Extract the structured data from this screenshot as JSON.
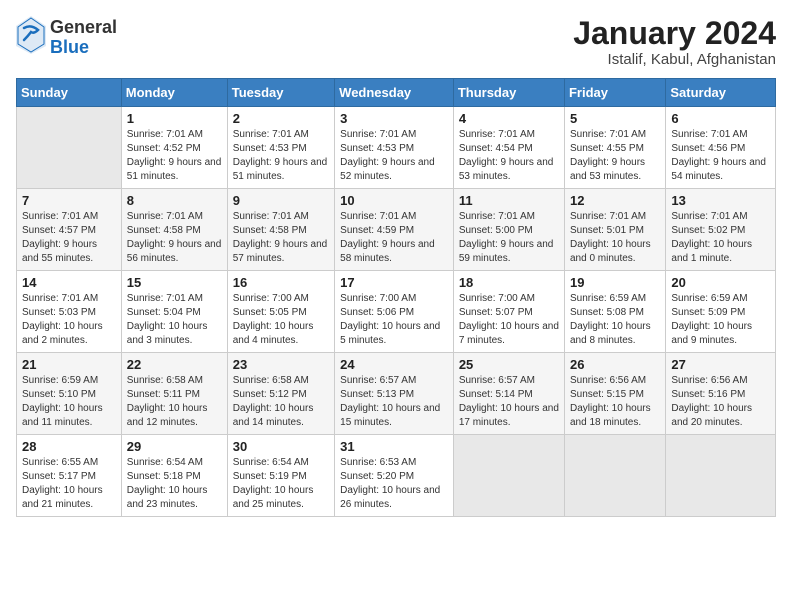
{
  "logo": {
    "general": "General",
    "blue": "Blue"
  },
  "title": "January 2024",
  "subtitle": "Istalif, Kabul, Afghanistan",
  "headers": [
    "Sunday",
    "Monday",
    "Tuesday",
    "Wednesday",
    "Thursday",
    "Friday",
    "Saturday"
  ],
  "weeks": [
    [
      {
        "day": "",
        "sunrise": "",
        "sunset": "",
        "daylight": ""
      },
      {
        "day": "1",
        "sunrise": "Sunrise: 7:01 AM",
        "sunset": "Sunset: 4:52 PM",
        "daylight": "Daylight: 9 hours and 51 minutes."
      },
      {
        "day": "2",
        "sunrise": "Sunrise: 7:01 AM",
        "sunset": "Sunset: 4:53 PM",
        "daylight": "Daylight: 9 hours and 51 minutes."
      },
      {
        "day": "3",
        "sunrise": "Sunrise: 7:01 AM",
        "sunset": "Sunset: 4:53 PM",
        "daylight": "Daylight: 9 hours and 52 minutes."
      },
      {
        "day": "4",
        "sunrise": "Sunrise: 7:01 AM",
        "sunset": "Sunset: 4:54 PM",
        "daylight": "Daylight: 9 hours and 53 minutes."
      },
      {
        "day": "5",
        "sunrise": "Sunrise: 7:01 AM",
        "sunset": "Sunset: 4:55 PM",
        "daylight": "Daylight: 9 hours and 53 minutes."
      },
      {
        "day": "6",
        "sunrise": "Sunrise: 7:01 AM",
        "sunset": "Sunset: 4:56 PM",
        "daylight": "Daylight: 9 hours and 54 minutes."
      }
    ],
    [
      {
        "day": "7",
        "sunrise": "Sunrise: 7:01 AM",
        "sunset": "Sunset: 4:57 PM",
        "daylight": "Daylight: 9 hours and 55 minutes."
      },
      {
        "day": "8",
        "sunrise": "Sunrise: 7:01 AM",
        "sunset": "Sunset: 4:58 PM",
        "daylight": "Daylight: 9 hours and 56 minutes."
      },
      {
        "day": "9",
        "sunrise": "Sunrise: 7:01 AM",
        "sunset": "Sunset: 4:58 PM",
        "daylight": "Daylight: 9 hours and 57 minutes."
      },
      {
        "day": "10",
        "sunrise": "Sunrise: 7:01 AM",
        "sunset": "Sunset: 4:59 PM",
        "daylight": "Daylight: 9 hours and 58 minutes."
      },
      {
        "day": "11",
        "sunrise": "Sunrise: 7:01 AM",
        "sunset": "Sunset: 5:00 PM",
        "daylight": "Daylight: 9 hours and 59 minutes."
      },
      {
        "day": "12",
        "sunrise": "Sunrise: 7:01 AM",
        "sunset": "Sunset: 5:01 PM",
        "daylight": "Daylight: 10 hours and 0 minutes."
      },
      {
        "day": "13",
        "sunrise": "Sunrise: 7:01 AM",
        "sunset": "Sunset: 5:02 PM",
        "daylight": "Daylight: 10 hours and 1 minute."
      }
    ],
    [
      {
        "day": "14",
        "sunrise": "Sunrise: 7:01 AM",
        "sunset": "Sunset: 5:03 PM",
        "daylight": "Daylight: 10 hours and 2 minutes."
      },
      {
        "day": "15",
        "sunrise": "Sunrise: 7:01 AM",
        "sunset": "Sunset: 5:04 PM",
        "daylight": "Daylight: 10 hours and 3 minutes."
      },
      {
        "day": "16",
        "sunrise": "Sunrise: 7:00 AM",
        "sunset": "Sunset: 5:05 PM",
        "daylight": "Daylight: 10 hours and 4 minutes."
      },
      {
        "day": "17",
        "sunrise": "Sunrise: 7:00 AM",
        "sunset": "Sunset: 5:06 PM",
        "daylight": "Daylight: 10 hours and 5 minutes."
      },
      {
        "day": "18",
        "sunrise": "Sunrise: 7:00 AM",
        "sunset": "Sunset: 5:07 PM",
        "daylight": "Daylight: 10 hours and 7 minutes."
      },
      {
        "day": "19",
        "sunrise": "Sunrise: 6:59 AM",
        "sunset": "Sunset: 5:08 PM",
        "daylight": "Daylight: 10 hours and 8 minutes."
      },
      {
        "day": "20",
        "sunrise": "Sunrise: 6:59 AM",
        "sunset": "Sunset: 5:09 PM",
        "daylight": "Daylight: 10 hours and 9 minutes."
      }
    ],
    [
      {
        "day": "21",
        "sunrise": "Sunrise: 6:59 AM",
        "sunset": "Sunset: 5:10 PM",
        "daylight": "Daylight: 10 hours and 11 minutes."
      },
      {
        "day": "22",
        "sunrise": "Sunrise: 6:58 AM",
        "sunset": "Sunset: 5:11 PM",
        "daylight": "Daylight: 10 hours and 12 minutes."
      },
      {
        "day": "23",
        "sunrise": "Sunrise: 6:58 AM",
        "sunset": "Sunset: 5:12 PM",
        "daylight": "Daylight: 10 hours and 14 minutes."
      },
      {
        "day": "24",
        "sunrise": "Sunrise: 6:57 AM",
        "sunset": "Sunset: 5:13 PM",
        "daylight": "Daylight: 10 hours and 15 minutes."
      },
      {
        "day": "25",
        "sunrise": "Sunrise: 6:57 AM",
        "sunset": "Sunset: 5:14 PM",
        "daylight": "Daylight: 10 hours and 17 minutes."
      },
      {
        "day": "26",
        "sunrise": "Sunrise: 6:56 AM",
        "sunset": "Sunset: 5:15 PM",
        "daylight": "Daylight: 10 hours and 18 minutes."
      },
      {
        "day": "27",
        "sunrise": "Sunrise: 6:56 AM",
        "sunset": "Sunset: 5:16 PM",
        "daylight": "Daylight: 10 hours and 20 minutes."
      }
    ],
    [
      {
        "day": "28",
        "sunrise": "Sunrise: 6:55 AM",
        "sunset": "Sunset: 5:17 PM",
        "daylight": "Daylight: 10 hours and 21 minutes."
      },
      {
        "day": "29",
        "sunrise": "Sunrise: 6:54 AM",
        "sunset": "Sunset: 5:18 PM",
        "daylight": "Daylight: 10 hours and 23 minutes."
      },
      {
        "day": "30",
        "sunrise": "Sunrise: 6:54 AM",
        "sunset": "Sunset: 5:19 PM",
        "daylight": "Daylight: 10 hours and 25 minutes."
      },
      {
        "day": "31",
        "sunrise": "Sunrise: 6:53 AM",
        "sunset": "Sunset: 5:20 PM",
        "daylight": "Daylight: 10 hours and 26 minutes."
      },
      {
        "day": "",
        "sunrise": "",
        "sunset": "",
        "daylight": ""
      },
      {
        "day": "",
        "sunrise": "",
        "sunset": "",
        "daylight": ""
      },
      {
        "day": "",
        "sunrise": "",
        "sunset": "",
        "daylight": ""
      }
    ]
  ]
}
